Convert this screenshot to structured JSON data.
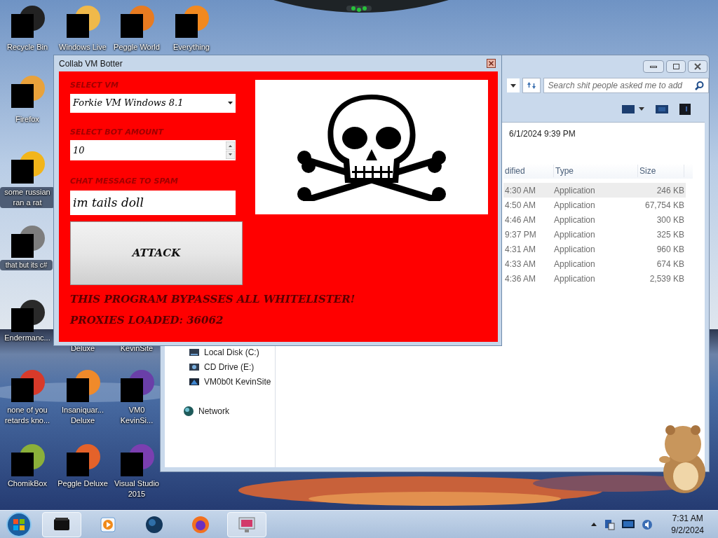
{
  "desktop_icons": [
    {
      "label_lines": [
        "Recycle Bin"
      ],
      "kind": "icon"
    },
    {
      "label_lines": [
        "Windows Live"
      ],
      "kind": "icon"
    },
    {
      "label_lines": [
        "Peggle World"
      ],
      "kind": "icon"
    },
    {
      "label_lines": [
        "Everything"
      ],
      "kind": "icon"
    },
    {
      "label_lines": [
        "Firefox"
      ],
      "kind": "icon"
    },
    {
      "label_lines": [
        "some russian",
        "ran a rat"
      ],
      "kind": "icon"
    },
    {
      "label_lines": [
        "that but its c#"
      ],
      "kind": "icon"
    },
    {
      "label_lines": [
        "Endermanc..."
      ],
      "kind": "icon"
    },
    {
      "label_lines": [
        "Deluxe"
      ],
      "kind": "covered"
    },
    {
      "label_lines": [
        "KevinSite"
      ],
      "kind": "covered"
    },
    {
      "label_lines": [
        "none of you",
        "retards kno..."
      ],
      "kind": "icon"
    },
    {
      "label_lines": [
        "Insaniquar...",
        "Deluxe"
      ],
      "kind": "icon"
    },
    {
      "label_lines": [
        "VM0",
        "KevinSi..."
      ],
      "kind": "icon"
    },
    {
      "label_lines": [
        "ChomikBox"
      ],
      "kind": "icon"
    },
    {
      "label_lines": [
        "Peggle Deluxe"
      ],
      "kind": "icon"
    },
    {
      "label_lines": [
        "Visual Studio",
        "2015"
      ],
      "kind": "icon"
    }
  ],
  "explorer": {
    "search": {
      "placeholder": "Search shit people asked me to add"
    },
    "date_text": "6/1/2024 9:39 PM",
    "columns": [
      "dified",
      "Type",
      "Size"
    ],
    "rows": [
      {
        "time": "4:30 AM",
        "type": "Application",
        "size": "246 KB",
        "selected": true
      },
      {
        "time": "4:50 AM",
        "type": "Application",
        "size": "67,754 KB",
        "selected": false
      },
      {
        "time": "4:46 AM",
        "type": "Application",
        "size": "300 KB",
        "selected": false
      },
      {
        "time": "9:37 PM",
        "type": "Application",
        "size": "325 KB",
        "selected": false
      },
      {
        "time": "4:31 AM",
        "type": "Application",
        "size": "960 KB",
        "selected": false
      },
      {
        "time": "4:33 AM",
        "type": "Application",
        "size": "674 KB",
        "selected": false
      },
      {
        "time": "4:36 AM",
        "type": "Application",
        "size": "2,539 KB",
        "selected": false
      }
    ],
    "nav_items": [
      {
        "label": "Local Disk (C:)",
        "kind": "disk"
      },
      {
        "label": "CD Drive (E:)",
        "kind": "cd"
      },
      {
        "label": "VM0b0t KevinSite",
        "kind": "share"
      },
      {
        "label": "Network",
        "kind": "network"
      }
    ]
  },
  "botter": {
    "title": "Collab VM Botter",
    "vm_label": "SELECT VM",
    "vm_value": "Forkie VM Windows 8.1",
    "amount_label": "SELECT BOT AMOUNT",
    "amount_value": "10",
    "message_label": "CHAT MESSAGE TO SPAM",
    "message_value": "im tails doll",
    "button": "ATTACK",
    "notes": [
      "THIS PROGRAM BYPASSES ALL WHITELISTER!",
      "PROXIES LOADED: 36062"
    ]
  },
  "taskbar": {
    "buttons": [
      {
        "kind": "black-box",
        "selected": true
      },
      {
        "kind": "media",
        "selected": false
      },
      {
        "kind": "globe",
        "selected": false
      },
      {
        "kind": "fox",
        "selected": false
      },
      {
        "kind": "monitor",
        "selected": true
      }
    ],
    "time": "7:31 AM",
    "date": "9/2/2024"
  }
}
